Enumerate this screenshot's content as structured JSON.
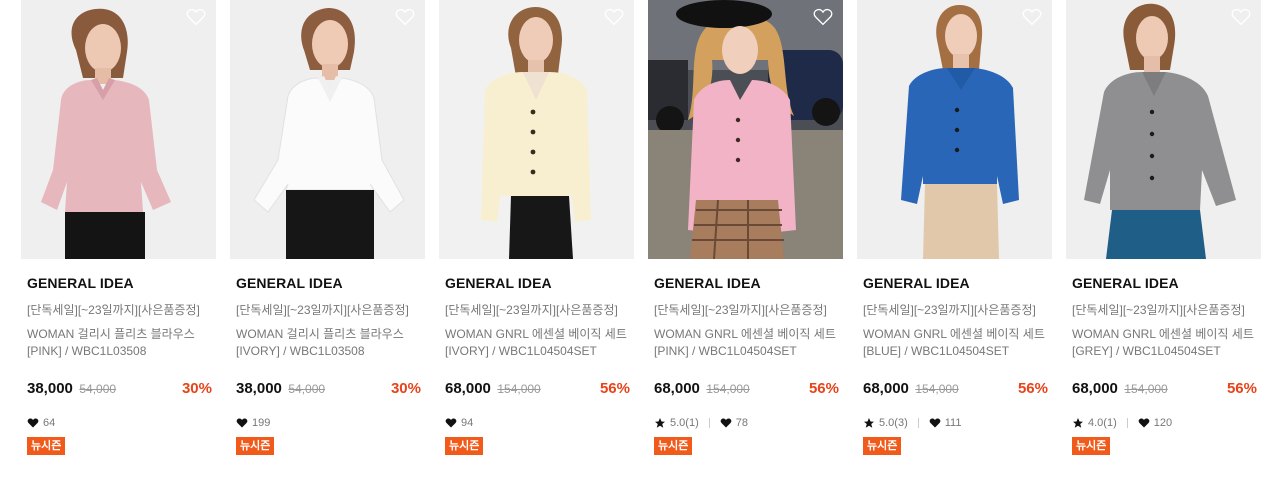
{
  "colors": {
    "discount": "#e8431a",
    "badge_bg": "#f05a1a",
    "muted_text": "#777777"
  },
  "products": [
    {
      "brand": "GENERAL IDEA",
      "promo": "[단독세일][~23일까지][사은품증정]",
      "name": "WOMAN 걸리시 플리츠 블라우스 [PINK] / WBC1L03508",
      "price": "38,000",
      "original_price": "54,000",
      "discount": "30%",
      "rating": "",
      "likes": "64",
      "badge": "뉴시즌",
      "image_desc": "model-pink-blouse"
    },
    {
      "brand": "GENERAL IDEA",
      "promo": "[단독세일][~23일까지][사은품증정]",
      "name": "WOMAN 걸리시 플리츠 블라우스 [IVORY] / WBC1L03508",
      "price": "38,000",
      "original_price": "54,000",
      "discount": "30%",
      "rating": "",
      "likes": "199",
      "badge": "뉴시즌",
      "image_desc": "model-ivory-blouse"
    },
    {
      "brand": "GENERAL IDEA",
      "promo": "[단독세일][~23일까지][사은품증정]",
      "name": "WOMAN GNRL 에센셜 베이직 세트 [IVORY] / WBC1L04504SET",
      "price": "68,000",
      "original_price": "154,000",
      "discount": "56%",
      "rating": "",
      "likes": "94",
      "badge": "뉴시즌",
      "image_desc": "model-ivory-cardigan"
    },
    {
      "brand": "GENERAL IDEA",
      "promo": "[단독세일][~23일까지][사은품증정]",
      "name": "WOMAN GNRL 에센셜 베이직 세트 [PINK] / WBC1L04504SET",
      "price": "68,000",
      "original_price": "154,000",
      "discount": "56%",
      "rating": "5.0(1)",
      "likes": "78",
      "badge": "뉴시즌",
      "image_desc": "model-pink-cardigan-street"
    },
    {
      "brand": "GENERAL IDEA",
      "promo": "[단독세일][~23일까지][사은품증정]",
      "name": "WOMAN GNRL 에센셜 베이직 세트 [BLUE] / WBC1L04504SET",
      "price": "68,000",
      "original_price": "154,000",
      "discount": "56%",
      "rating": "5.0(3)",
      "likes": "111",
      "badge": "뉴시즌",
      "image_desc": "model-blue-cardigan"
    },
    {
      "brand": "GENERAL IDEA",
      "promo": "[단독세일][~23일까지][사은품증정]",
      "name": "WOMAN GNRL 에센셜 베이직 세트 [GREY] / WBC1L04504SET",
      "price": "68,000",
      "original_price": "154,000",
      "discount": "56%",
      "rating": "4.0(1)",
      "likes": "120",
      "badge": "뉴시즌",
      "image_desc": "model-grey-cardigan"
    }
  ]
}
